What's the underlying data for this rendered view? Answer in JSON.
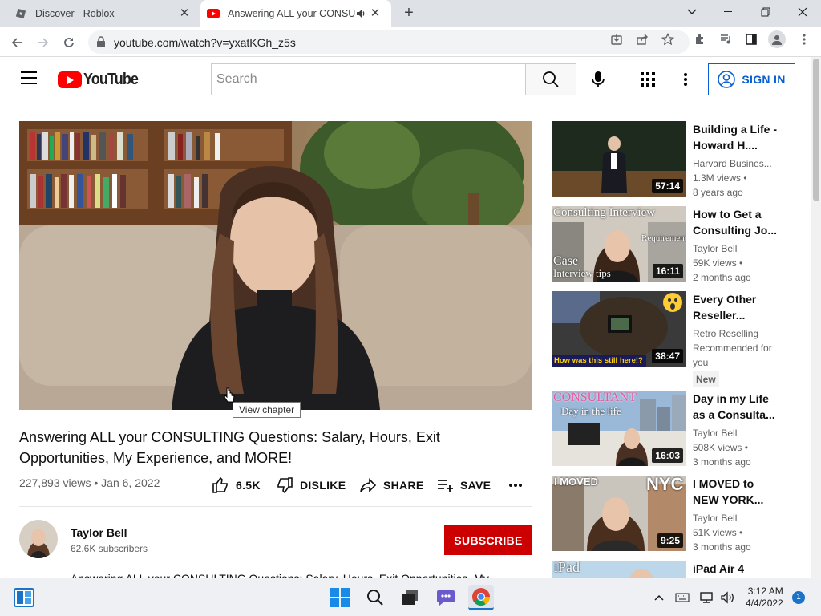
{
  "browser": {
    "tabs": [
      {
        "title": "Discover - Roblox",
        "icon": "roblox-icon"
      },
      {
        "title": "Answering ALL your CONSUL",
        "icon": "youtube-icon",
        "active": true
      }
    ],
    "url": "youtube.com/watch?v=yxatKGh_z5s"
  },
  "youtube": {
    "logo_text": "YouTube",
    "search_placeholder": "Search",
    "signin_label": "SIGN IN"
  },
  "video": {
    "tooltip": "View chapter",
    "title": "Answering ALL your CONSULTING Questions: Salary, Hours, Exit Opportunities, My Experience, and MORE!",
    "meta": "227,893 views • Jan 6, 2022",
    "likes": "6.5K",
    "dislike_label": "DISLIKE",
    "share_label": "SHARE",
    "save_label": "SAVE",
    "channel": "Taylor Bell",
    "subscribers": "62.6K subscribers",
    "subscribe_label": "SUBSCRIBE",
    "description": "Answering ALL your CONSULTING Questions: Salary, Hours, Exit Opportunities, My"
  },
  "recommendations": [
    {
      "title": "Building a Life - Howard H....",
      "channel": "Harvard Busines...",
      "views": "1.3M views •",
      "age": "8 years ago",
      "duration": "57:14"
    },
    {
      "title": "How to Get a Consulting Jo...",
      "channel": "Taylor Bell",
      "views": "59K views •",
      "age": "2 months ago",
      "duration": "16:11",
      "thumb_text": "Consulting Interview",
      "thumb_sub": "Requirements",
      "thumb_case": "Case",
      "thumb_tips": "Interview tips"
    },
    {
      "title": "Every Other Reseller...",
      "channel": "Retro Reselling",
      "views": "Recommended for",
      "age": "you",
      "badge": "New",
      "duration": "38:47",
      "thumb_caption": "How was this still here!?"
    },
    {
      "title": "Day in my Life as a Consulta...",
      "channel": "Taylor Bell",
      "views": "508K views •",
      "age": "3 months ago",
      "duration": "16:03",
      "thumb_text": "CONSULTANT",
      "thumb_sub": "Day in the life"
    },
    {
      "title": "I MOVED to NEW YORK...",
      "channel": "Taylor Bell",
      "views": "51K views •",
      "age": "3 months ago",
      "duration": "9:25",
      "thumb_text": "I MOVED",
      "thumb_sub": "NYC"
    },
    {
      "title": "iPad Air 4",
      "thumb_text": "iPad"
    }
  ],
  "taskbar": {
    "time": "3:12 AM",
    "date": "4/4/2022",
    "notifications": "1"
  }
}
